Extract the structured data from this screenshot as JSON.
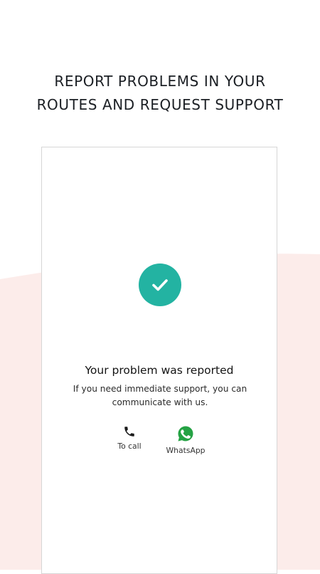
{
  "headline": {
    "line1": "REPORT PROBLEMS IN YOUR",
    "line2": "ROUTES AND REQUEST SUPPORT"
  },
  "card": {
    "status_icon": "check-icon",
    "title": "Your problem was reported",
    "subtitle": "If you need immediate support, you can communicate with us.",
    "actions": [
      {
        "label": "To call",
        "icon": "phone-icon"
      },
      {
        "label": "WhatsApp",
        "icon": "whatsapp-icon"
      }
    ]
  },
  "colors": {
    "accent": "#23b3a2",
    "whatsapp": "#25a244",
    "background_wave": "#fcecea",
    "text": "#1b1f24"
  }
}
